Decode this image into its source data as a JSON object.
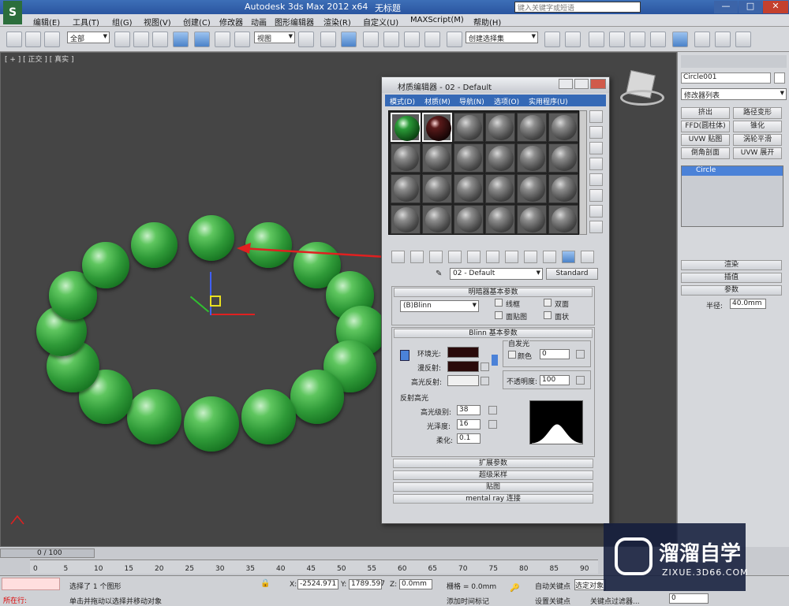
{
  "window": {
    "title": "Autodesk 3ds Max  2012 x64",
    "doc": "无标题",
    "search_placeholder": "键入关键字或短语"
  },
  "menu": [
    "编辑(E)",
    "工具(T)",
    "组(G)",
    "视图(V)",
    "创建(C)",
    "修改器",
    "动画",
    "图形编辑器",
    "渲染(R)",
    "自定义(U)",
    "MAXScript(M)",
    "帮助(H)"
  ],
  "toolbar": {
    "selection_filter": "全部",
    "view_dropdown": "视图",
    "named_sel": "创建选择集"
  },
  "viewport": {
    "label": "[ + ] [ 正交 ] [ 真实 ]"
  },
  "command_panel": {
    "object_name": "Circle001",
    "modifier_list": "修改器列表",
    "modifiers": [
      "挤出",
      "路径变形",
      "FFD(圆柱体)",
      "锥化",
      "UVW 贴图",
      "涡轮平滑",
      "倒角剖面",
      "UVW 展开"
    ],
    "stack_item": "Circle",
    "rollouts": [
      "渲染",
      "插值",
      "参数"
    ],
    "radius_label": "半径:",
    "radius_value": "40.0mm"
  },
  "material_editor": {
    "title": "材质编辑器 - 02 - Default",
    "menus": [
      "模式(D)",
      "材质(M)",
      "导航(N)",
      "选项(O)",
      "实用程序(U)"
    ],
    "material_name": "02 - Default",
    "material_type": "Standard",
    "shader_rollout": "明暗器基本参数",
    "shader": "(B)Blinn",
    "opts": [
      "线框",
      "双面",
      "面贴图",
      "面状"
    ],
    "blinn_rollout": "Blinn 基本参数",
    "self_illum": "自发光",
    "color_label": "颜色",
    "color_value": "0",
    "ambient": "环境光:",
    "diffuse": "漫反射:",
    "specular": "高光反射:",
    "opacity_label": "不透明度:",
    "opacity_value": "100",
    "spec_highlights": "反射高光",
    "spec_level_label": "高光级别:",
    "spec_level": "38",
    "gloss_label": "光泽度:",
    "gloss": "16",
    "soften_label": "柔化:",
    "soften": "0.1",
    "collapsed": [
      "扩展参数",
      "超级采样",
      "贴图",
      "mental ray 连接"
    ],
    "colors": {
      "ambient": "#2a0a0a",
      "diffuse": "#2a0a0a",
      "specular": "#f0f0f0"
    }
  },
  "timeline": {
    "frame": "0 / 100",
    "ticks": [
      "0",
      "5",
      "10",
      "15",
      "20",
      "25",
      "30",
      "35",
      "40",
      "45",
      "50",
      "55",
      "60",
      "65",
      "70",
      "75",
      "80",
      "85",
      "90"
    ]
  },
  "status": {
    "selected": "选择了 1 个图形",
    "prompt": "单击并拖动以选择并移动对象",
    "running": "所在行:",
    "x_label": "X:",
    "x": "-2524.971",
    "y_label": "Y:",
    "y": "1789.597",
    "z_label": "Z:",
    "z": "0.0mm",
    "grid": "栅格 = 0.0mm",
    "autokey": "自动关键点",
    "selected_obj": "选定对象",
    "setkey": "设置关键点",
    "key_filters": "关键点过滤器...",
    "add_time_tag": "添加时间标记",
    "frame_field": "0"
  },
  "watermark": {
    "brand": "溜溜自学",
    "url": "ZIXUE.3D66.COM"
  }
}
